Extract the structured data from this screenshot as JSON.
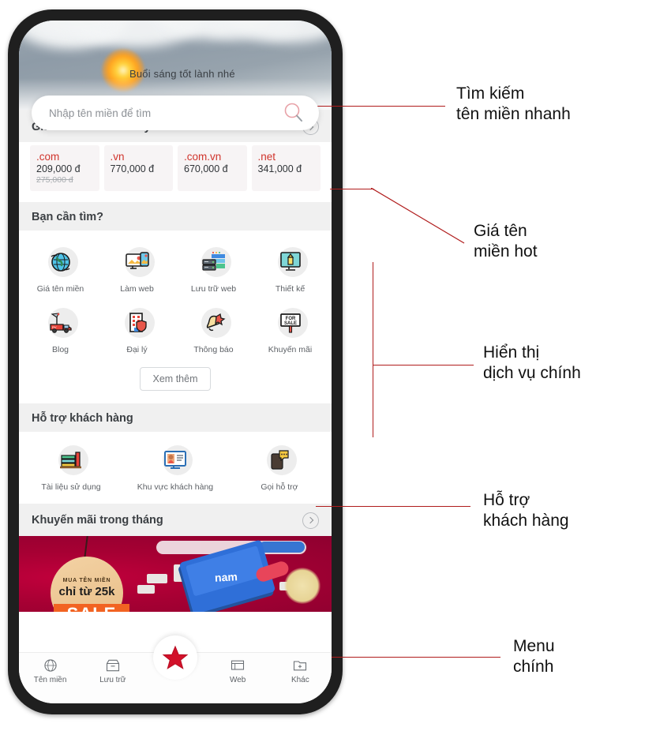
{
  "phone": {
    "header": {
      "greeting": "Buổi sáng tốt lành nhé",
      "search_placeholder": "Nhập tên miền để tìm",
      "search_icon": "search-icon"
    },
    "price_section": {
      "title": "Giá tên miền hôm nay",
      "chevron_icon": "chevron-right-icon",
      "items": [
        {
          "tld": ".com",
          "price": "209,000 đ",
          "old_price": "275,000 đ"
        },
        {
          "tld": ".vn",
          "price": "770,000 đ",
          "old_price": ""
        },
        {
          "tld": ".com.vn",
          "price": "670,000 đ",
          "old_price": ""
        },
        {
          "tld": ".net",
          "price": "341,000 đ",
          "old_price": ""
        }
      ]
    },
    "services_section": {
      "title": "Bạn cần tìm?",
      "items": [
        {
          "label": "Giá tên miền",
          "icon": "globe-icon"
        },
        {
          "label": "Làm web",
          "icon": "monitor-phone-icon"
        },
        {
          "label": "Lưu trữ web",
          "icon": "server-icon"
        },
        {
          "label": "Thiết kế",
          "icon": "monitor-pencil-icon"
        },
        {
          "label": "Blog",
          "icon": "news-van-icon"
        },
        {
          "label": "Đại lý",
          "icon": "building-shield-icon"
        },
        {
          "label": "Thông báo",
          "icon": "bell-icon"
        },
        {
          "label": "Khuyến mãi",
          "icon": "for-sale-sign-icon"
        }
      ],
      "more_button": "Xem thêm"
    },
    "support_section": {
      "title": "Hỗ trợ khách hàng",
      "items": [
        {
          "label": "Tài liệu sử dụng",
          "icon": "books-icon"
        },
        {
          "label": "Khu vực khách hàng",
          "icon": "customer-monitor-icon"
        },
        {
          "label": "Gọi hỗ trợ",
          "icon": "phone-chat-icon"
        }
      ]
    },
    "promo_section": {
      "title": "Khuyến mãi trong tháng",
      "chevron_icon": "chevron-right-icon",
      "banner": {
        "tag_line1": "MUA TÊN MIỀN",
        "tag_line2": "chỉ từ 25k",
        "sale_text": "SALE",
        "laptop_label": "nam",
        "search_button": "search"
      }
    },
    "bottom_nav": {
      "items": [
        {
          "label": "Tên miền",
          "icon": "globe-icon"
        },
        {
          "label": "Lưu trữ",
          "icon": "archive-box-icon"
        },
        {
          "label": "",
          "icon": "red-star-icon"
        },
        {
          "label": "Web",
          "icon": "web-icon"
        },
        {
          "label": "Khác",
          "icon": "folder-plus-icon"
        }
      ]
    }
  },
  "annotations": [
    {
      "text": "Tìm kiếm\ntên miền nhanh"
    },
    {
      "text": "Giá tên\nmiền hot"
    },
    {
      "text": "Hiển thị\ndịch vụ chính"
    },
    {
      "text": "Hỗ trợ\nkhách hàng"
    },
    {
      "text": "Menu\nchính"
    }
  ],
  "colors": {
    "accent_red": "#d0342c",
    "annotation_line": "#b01c1c",
    "banner_bg": "#a60033",
    "frame": "#1f1f1f"
  }
}
